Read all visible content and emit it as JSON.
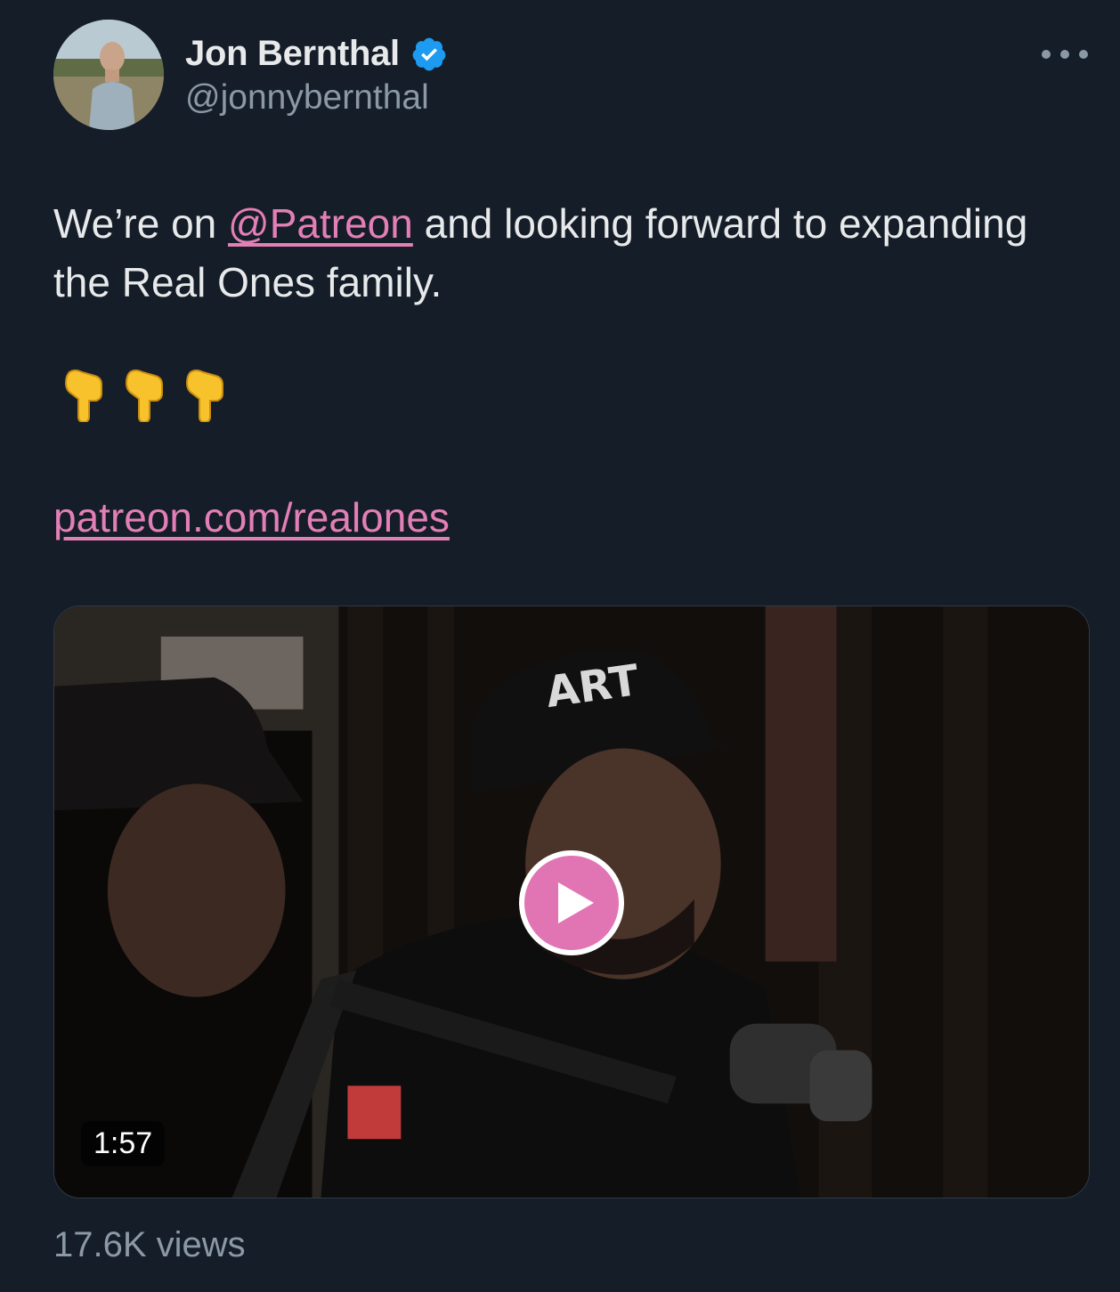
{
  "author": {
    "display_name": "Jon Bernthal",
    "handle": "@jonnybernthal",
    "verified": true
  },
  "tweet": {
    "text_before": "We’re on ",
    "mention": "@Patreon",
    "text_after": " and looking forward to expanding the Real Ones family.",
    "emojis": [
      "👇",
      "👇",
      "👇"
    ],
    "link": "patreon.com/realones"
  },
  "media": {
    "duration": "1:57",
    "cap_text": "ART"
  },
  "stats": {
    "views": "17.6K views"
  },
  "colors": {
    "background": "#151d28",
    "link": "#e27fb6",
    "verified_badge": "#1d9bf0",
    "secondary_text": "#8b98a5",
    "play_button": "#e175b4"
  }
}
